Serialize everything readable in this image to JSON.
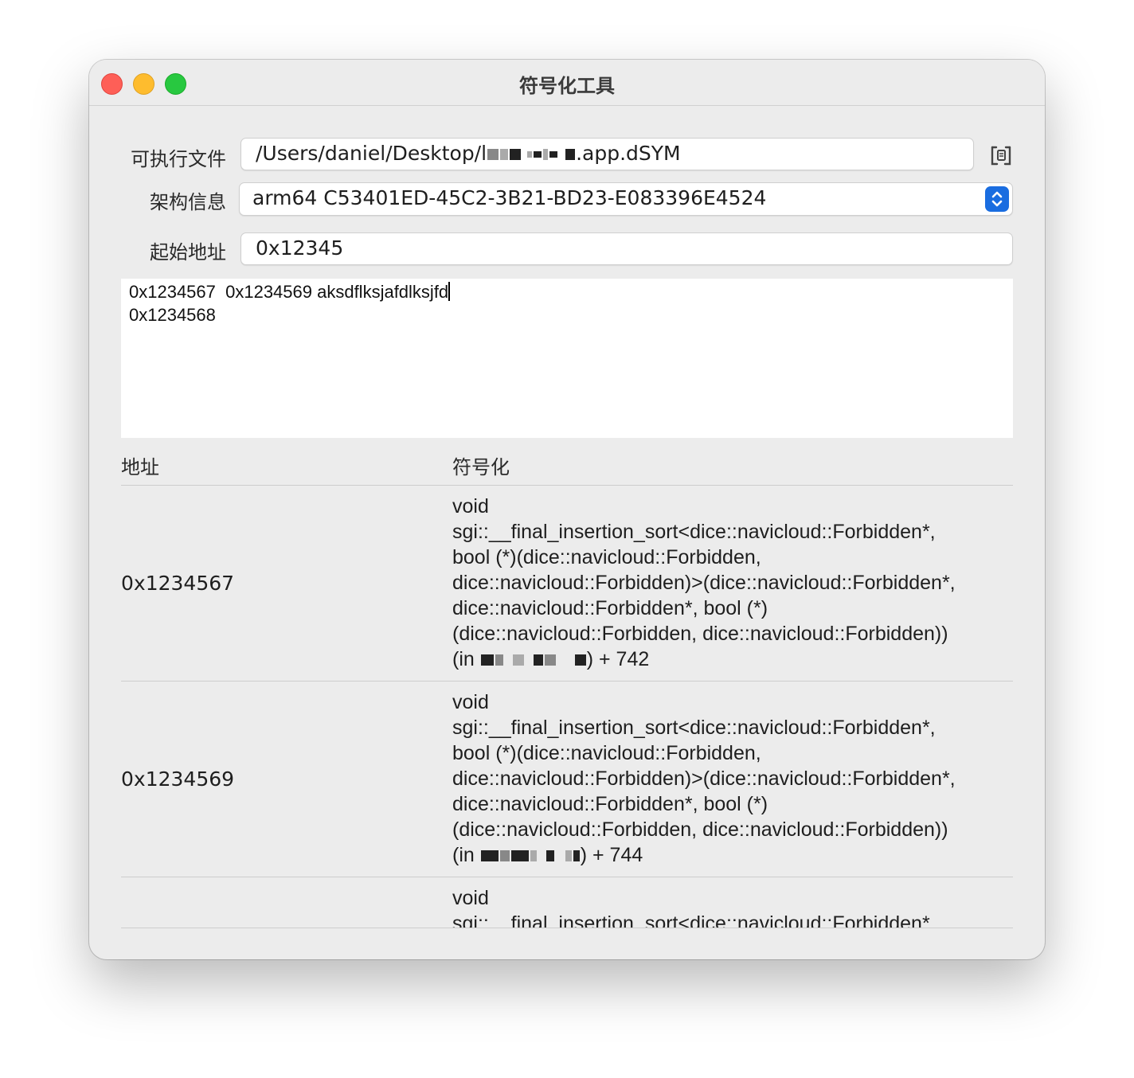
{
  "window": {
    "title": "符号化工具"
  },
  "form": {
    "exec_label": "可执行文件",
    "exec_prefix": "/Users/daniel/Desktop/l",
    "exec_suffix": ".app.dSYM",
    "arch_label": "架构信息",
    "arch_value": "arm64 C53401ED-45C2-3B21-BD23-E083396E4524",
    "start_label": "起始地址",
    "start_value": "0x12345"
  },
  "editor": {
    "line1": "0x1234567  0x1234569 aksdflksjafdlksjfd",
    "line2": "0x1234568"
  },
  "table": {
    "col_address": "地址",
    "col_symbol": "符号化",
    "rows": [
      {
        "address": "0x1234567",
        "symbol_lines": [
          "void",
          "sgi::__final_insertion_sort<dice::navicloud::Forbidden*,",
          "bool (*)(dice::navicloud::Forbidden,",
          "dice::navicloud::Forbidden)>(dice::navicloud::Forbidden*,",
          "dice::navicloud::Forbidden*, bool (*)",
          "(dice::navicloud::Forbidden, dice::navicloud::Forbidden))"
        ],
        "tail_prefix": "(in ",
        "tail_suffix": ") + 742"
      },
      {
        "address": "0x1234569",
        "symbol_lines": [
          "void",
          "sgi::__final_insertion_sort<dice::navicloud::Forbidden*,",
          "bool (*)(dice::navicloud::Forbidden,",
          "dice::navicloud::Forbidden)>(dice::navicloud::Forbidden*,",
          "dice::navicloud::Forbidden*, bool (*)",
          "(dice::navicloud::Forbidden, dice::navicloud::Forbidden))"
        ],
        "tail_prefix": "(in ",
        "tail_suffix": ") + 744"
      },
      {
        "address": "",
        "symbol_lines": [
          "void",
          "sgi::__final_insertion_sort<dice::navicloud::Forbidden*,"
        ],
        "tail_prefix": "",
        "tail_suffix": ""
      }
    ]
  }
}
